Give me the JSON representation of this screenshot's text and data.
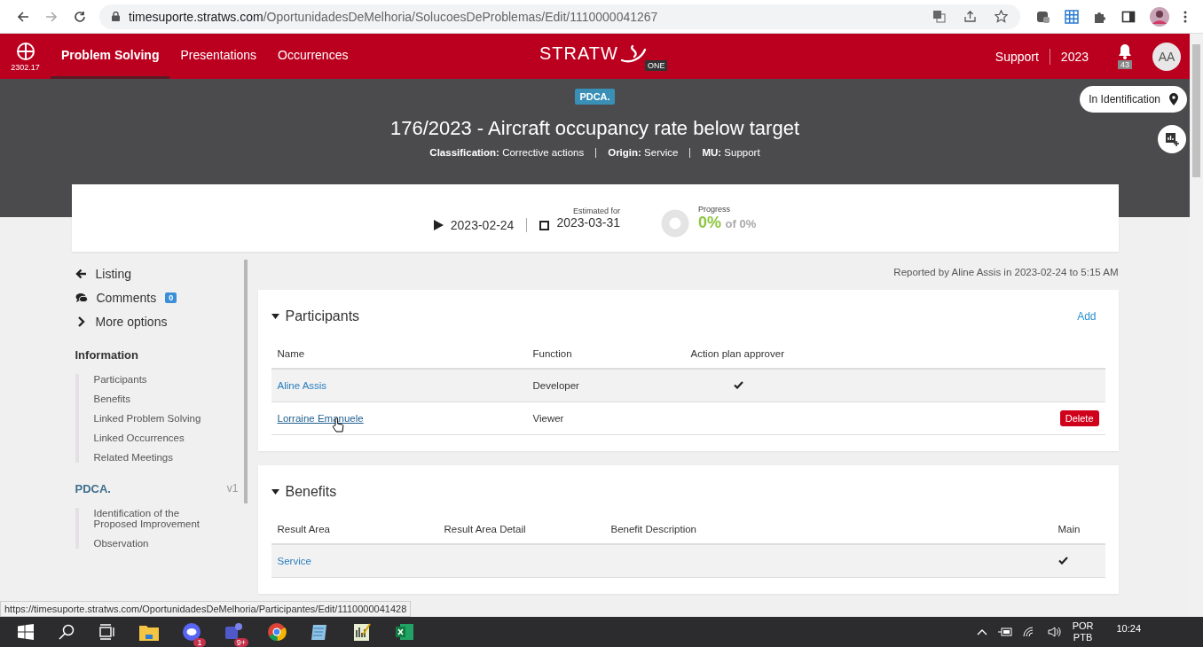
{
  "browser": {
    "url_host": "timesuporte.stratws.com",
    "url_path": "/OportunidadesDeMelhoria/SolucoesDeProblemas/Edit/1110000041267"
  },
  "header": {
    "version": "2302.17",
    "nav": [
      {
        "label": "Problem Solving",
        "selected": true
      },
      {
        "label": "Presentations",
        "selected": false
      },
      {
        "label": "Occurrences",
        "selected": false
      }
    ],
    "logo": "STRATW",
    "logo_badge": "ONE",
    "unit": "Support",
    "year": "2023",
    "notifications": "43",
    "avatar": "AA"
  },
  "hero": {
    "badge": "PDCA.",
    "title": "176/2023 - Aircraft occupancy rate below target",
    "meta": [
      {
        "label": "Classification:",
        "value": "Corrective actions"
      },
      {
        "label": "Origin:",
        "value": "Service"
      },
      {
        "label": "MU:",
        "value": "Support"
      }
    ],
    "status": "In Identification"
  },
  "schedule": {
    "start": "2023-02-24",
    "estimated_label": "Estimated for",
    "end": "2023-03-31",
    "progress_label": "Progress",
    "level": 0,
    "progress": "0%",
    "progress_of": "of 0%"
  },
  "sidebar": {
    "actions": [
      {
        "kind": "back",
        "label": "Listing"
      },
      {
        "kind": "comments",
        "label": "Comments",
        "count": "0"
      },
      {
        "kind": "more",
        "label": "More options"
      }
    ],
    "sections": [
      {
        "title": "Information",
        "items": [
          "Participants",
          "Benefits",
          "Linked Problem Solving",
          "Linked Occurrences",
          "Related Meetings"
        ]
      },
      {
        "title": "PDCA.",
        "version": "v1",
        "items": [
          "Identification of the Proposed Improvement",
          "Observation"
        ]
      }
    ]
  },
  "reported": "Reported by Aline Assis in 2023-02-24 to 5:15 AM",
  "participants": {
    "title": "Participants",
    "add": "Add",
    "columns": [
      "Name",
      "Function",
      "Action plan approver"
    ],
    "rows": [
      {
        "name": "Aline Assis",
        "function": "Developer",
        "approver": true,
        "hovered": false
      },
      {
        "name": "Lorraine Emanuele",
        "function": "Viewer",
        "approver": false,
        "hovered": true,
        "delete": "Delete"
      }
    ]
  },
  "benefits": {
    "title": "Benefits",
    "columns": [
      "Result Area",
      "Result Area Detail",
      "Benefit Description",
      "Main"
    ],
    "rows": [
      {
        "result_area": "Service",
        "main": true
      }
    ]
  },
  "status_url": "https://timesuporte.stratws.com/OportunidadesDeMelhoria/Participantes/Edit/1110000041428",
  "taskbar": {
    "apps": [
      {
        "kind": "folder"
      },
      {
        "kind": "chat",
        "badge": "1"
      },
      {
        "kind": "teams",
        "badge": "9+"
      },
      {
        "kind": "browser"
      },
      {
        "kind": "notepad"
      },
      {
        "kind": "chart"
      },
      {
        "kind": "spreadsheet"
      }
    ],
    "language": [
      "POR",
      "PTB"
    ],
    "time": "10:24"
  }
}
